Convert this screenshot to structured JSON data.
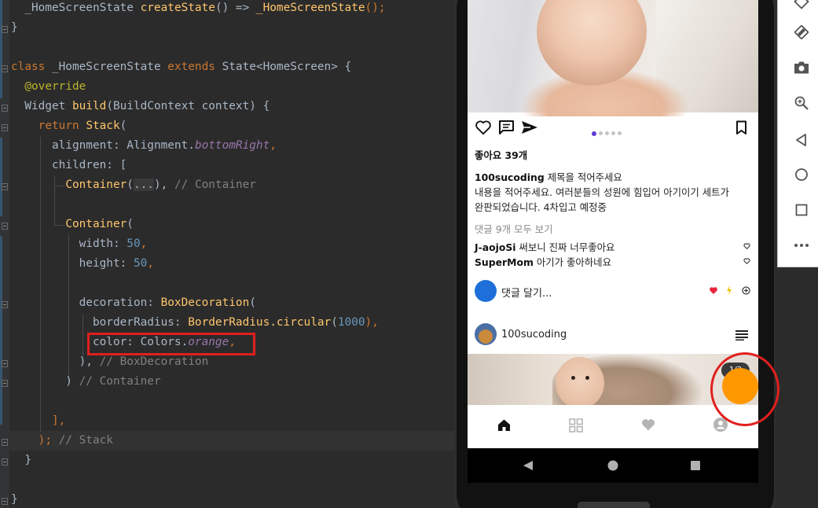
{
  "editor": {
    "lines": [
      {
        "segments": [
          {
            "t": "  _HomeScreenState ",
            "c": "pr"
          },
          {
            "t": "createState",
            "c": "fn"
          },
          {
            "t": "() => ",
            "c": "pr"
          },
          {
            "t": "_HomeScreenState",
            "c": "fn"
          },
          {
            "t": "();",
            "c": "kw"
          }
        ]
      },
      {
        "segments": [
          {
            "t": "}",
            "c": "pr"
          }
        ]
      },
      {
        "segments": []
      },
      {
        "segments": [
          {
            "t": "class ",
            "c": "kw"
          },
          {
            "t": "_HomeScreenState ",
            "c": "pr"
          },
          {
            "t": "extends ",
            "c": "kw"
          },
          {
            "t": "State<HomeScreen> {",
            "c": "pr"
          }
        ]
      },
      {
        "segments": [
          {
            "t": "  @override",
            "c": "ann"
          }
        ]
      },
      {
        "segments": [
          {
            "t": "  Widget ",
            "c": "pr"
          },
          {
            "t": "build",
            "c": "fn"
          },
          {
            "t": "(BuildContext context) {",
            "c": "pr"
          }
        ]
      },
      {
        "segments": [
          {
            "t": "    ",
            "c": "pr"
          },
          {
            "t": "return ",
            "c": "kw"
          },
          {
            "t": "Stack",
            "c": "fn"
          },
          {
            "t": "(",
            "c": "pr"
          }
        ]
      },
      {
        "segments": [
          {
            "t": "      alignment: Alignment.",
            "c": "pr"
          },
          {
            "t": "bottomRight",
            "c": "it"
          },
          {
            "t": ",",
            "c": "kw"
          }
        ]
      },
      {
        "segments": [
          {
            "t": "      children: [",
            "c": "pr"
          }
        ]
      },
      {
        "segments": [
          {
            "t": "        ",
            "c": "pr"
          },
          {
            "t": "Container",
            "c": "fn"
          },
          {
            "t": "(",
            "c": "pr"
          },
          {
            "t": "...",
            "c": "foldbox"
          },
          {
            "t": "), ",
            "c": "pr"
          },
          {
            "t": "// Container",
            "c": "cmt"
          }
        ]
      },
      {
        "segments": []
      },
      {
        "segments": [
          {
            "t": "        ",
            "c": "pr"
          },
          {
            "t": "Container",
            "c": "fn"
          },
          {
            "t": "(",
            "c": "pr"
          }
        ]
      },
      {
        "segments": [
          {
            "t": "          width: ",
            "c": "pr"
          },
          {
            "t": "50",
            "c": "num"
          },
          {
            "t": ",",
            "c": "kw"
          }
        ]
      },
      {
        "segments": [
          {
            "t": "          height: ",
            "c": "pr"
          },
          {
            "t": "50",
            "c": "num"
          },
          {
            "t": ",",
            "c": "kw"
          }
        ]
      },
      {
        "segments": []
      },
      {
        "segments": [
          {
            "t": "          decoration: ",
            "c": "pr"
          },
          {
            "t": "BoxDecoration",
            "c": "fn"
          },
          {
            "t": "(",
            "c": "pr"
          }
        ]
      },
      {
        "segments": [
          {
            "t": "            borderRadius: ",
            "c": "pr"
          },
          {
            "t": "BorderRadius.circular",
            "c": "fn"
          },
          {
            "t": "(",
            "c": "pr"
          },
          {
            "t": "1000",
            "c": "num"
          },
          {
            "t": "),",
            "c": "kw"
          }
        ]
      },
      {
        "segments": [
          {
            "t": "            color: Colors.",
            "c": "pr"
          },
          {
            "t": "orange",
            "c": "it"
          },
          {
            "t": ",",
            "c": "kw"
          }
        ]
      },
      {
        "segments": [
          {
            "t": "          ), ",
            "c": "pr"
          },
          {
            "t": "// BoxDecoration",
            "c": "cmt"
          }
        ]
      },
      {
        "segments": [
          {
            "t": "        ) ",
            "c": "pr"
          },
          {
            "t": "// Container",
            "c": "cmt"
          }
        ]
      },
      {
        "segments": []
      },
      {
        "segments": [
          {
            "t": "      ],",
            "c": "kw"
          }
        ]
      },
      {
        "segments": [
          {
            "t": "    );",
            "c": "kw"
          },
          {
            "t": " // Stack",
            "c": "cmt"
          }
        ]
      },
      {
        "segments": [
          {
            "t": "  }",
            "c": "pr"
          }
        ]
      },
      {
        "segments": []
      },
      {
        "segments": [
          {
            "t": "}",
            "c": "pr"
          }
        ]
      }
    ]
  },
  "post": {
    "likes": "좋아요 39개",
    "author": "100sucoding",
    "title": "제목을 적어주세요",
    "body_line1": "내용을 적어주세요. 여러분들의 성원에 힘입어 아기이기 세트가",
    "body_line2": "완판되었습니다. 4차입고 예정중",
    "view_comments": "댓글 9개 모두 보기",
    "comments": [
      {
        "user": "J-aojoSi",
        "text": "써보니 진짜 너무좋아요"
      },
      {
        "user": "SuperMom",
        "text": "아기가 좋아하네요"
      }
    ],
    "comment_placeholder": "댓글 달기...",
    "carousel_pages": 5,
    "carousel_active": 1
  },
  "next_post": {
    "author": "100sucoding",
    "badge": "1/3"
  },
  "fab": {
    "color": "#ff9800"
  },
  "icons": {
    "like": "heart-outline-icon",
    "comment": "comment-icon",
    "share": "send-icon",
    "bookmark": "bookmark-icon",
    "menu": "menu-lines-icon",
    "home": "home-icon",
    "grid": "grid-icon",
    "favorite": "heart-filled-icon",
    "profile": "account-circle-icon"
  },
  "toolbar": {
    "icons": [
      "rotate-left-icon",
      "rotate-right-icon",
      "camera-icon",
      "zoom-icon",
      "back-icon",
      "home-circle-icon",
      "overview-icon",
      "more-icon"
    ]
  }
}
